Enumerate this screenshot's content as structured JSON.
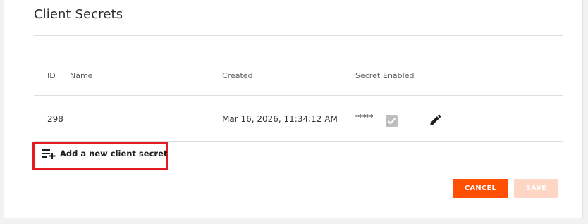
{
  "section": {
    "title": "Client Secrets"
  },
  "table": {
    "headers": {
      "id": "ID",
      "name": "Name",
      "created": "Created",
      "secret": "Secret",
      "enabled": "Enabled"
    },
    "rows": [
      {
        "id": "298",
        "name": "",
        "created": "Mar 16, 2026, 11:34:12 AM",
        "secret": "*****",
        "enabled": true
      }
    ]
  },
  "add_secret": {
    "label": "Add a new client secret",
    "icon": "playlist-add-icon"
  },
  "actions": {
    "cancel_label": "CANCEL",
    "save_label": "SAVE"
  },
  "colors": {
    "primary": "#ff4f00",
    "disabled_primary": "#ffd6c4",
    "highlight": "#e31b23",
    "checkbox": "#bdbdbd"
  }
}
